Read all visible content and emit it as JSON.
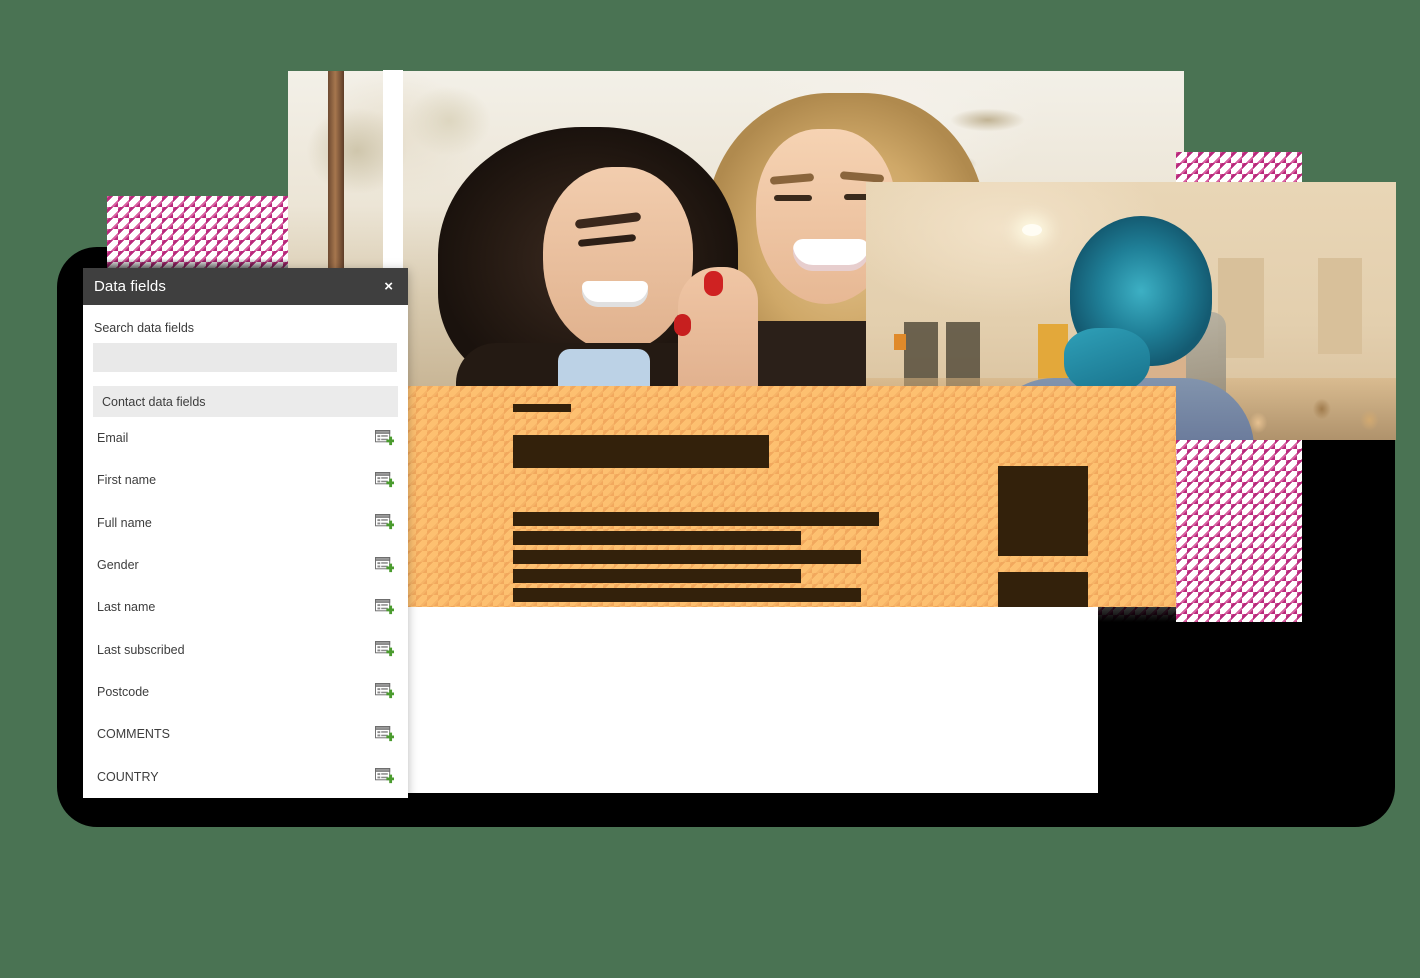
{
  "background_color": "#4a7353",
  "accent_colors": {
    "hatch_pink": "#b9297c",
    "panel_orange": "#fdc070",
    "bar_brown": "#33210b",
    "modal_header": "#3f3f3f",
    "add_icon_green": "#4a9b2e"
  },
  "modal": {
    "title": "Data fields",
    "close_label": "×",
    "close_icon": "close-icon",
    "search": {
      "label": "Search data fields",
      "value": "",
      "placeholder": ""
    },
    "group_header": "Contact data fields",
    "add_icon_name": "add-data-field-icon",
    "fields": [
      {
        "label": "Email"
      },
      {
        "label": "First name"
      },
      {
        "label": "Full name"
      },
      {
        "label": "Gender"
      },
      {
        "label": "Last name"
      },
      {
        "label": "Last subscribed"
      },
      {
        "label": "Postcode"
      },
      {
        "label": "COMMENTS"
      },
      {
        "label": "COUNTRY"
      }
    ]
  },
  "decorative": {
    "device_frame": "tablet-frame",
    "photo_1": "photo-two-women-laughing",
    "photo_2": "photo-person-blue-hair-audience",
    "hatch_blocks": [
      "hatch-top-left",
      "hatch-right",
      "hatch-under-orange"
    ],
    "content_placeholder_bars": 7
  }
}
